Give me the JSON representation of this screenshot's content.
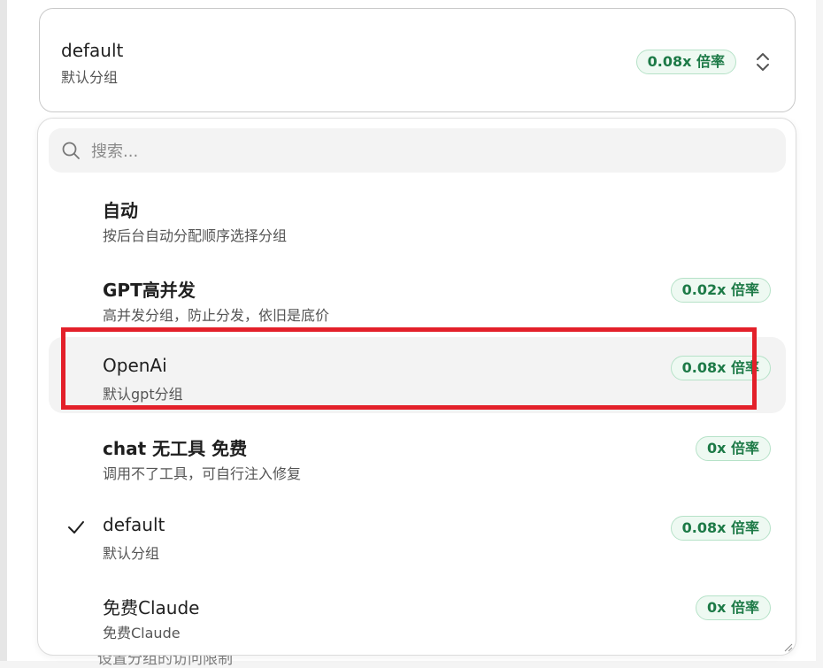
{
  "background": {
    "partial_text": "设置分组的访问限制"
  },
  "selected": {
    "title": "default",
    "subtitle": "默认分组",
    "badge": "0.08x 倍率",
    "chevron_icon": "chevron-up-down-icon"
  },
  "search": {
    "placeholder": "搜索...",
    "value": ""
  },
  "options": [
    {
      "title": "自动",
      "subtitle": "按后台自动分配顺序选择分组",
      "badge": ""
    },
    {
      "title": "GPT高并发",
      "subtitle": "高并发分组，防止分发，依旧是底价",
      "badge": "0.02x 倍率"
    },
    {
      "title": "OpenAi",
      "subtitle": "默认gpt分组",
      "badge": "0.08x 倍率"
    },
    {
      "title": "chat 无工具 免费",
      "subtitle": "调用不了工具，可自行注入修复",
      "badge": "0x 倍率"
    },
    {
      "title": "default",
      "subtitle": "默认分组",
      "badge": "0.08x 倍率",
      "checked": true
    },
    {
      "title": "免费Claude",
      "subtitle": "免费Claude",
      "badge": "0x 倍率"
    }
  ],
  "colors": {
    "accent_green": "#1d7a47",
    "highlight_border": "#e3202a"
  }
}
